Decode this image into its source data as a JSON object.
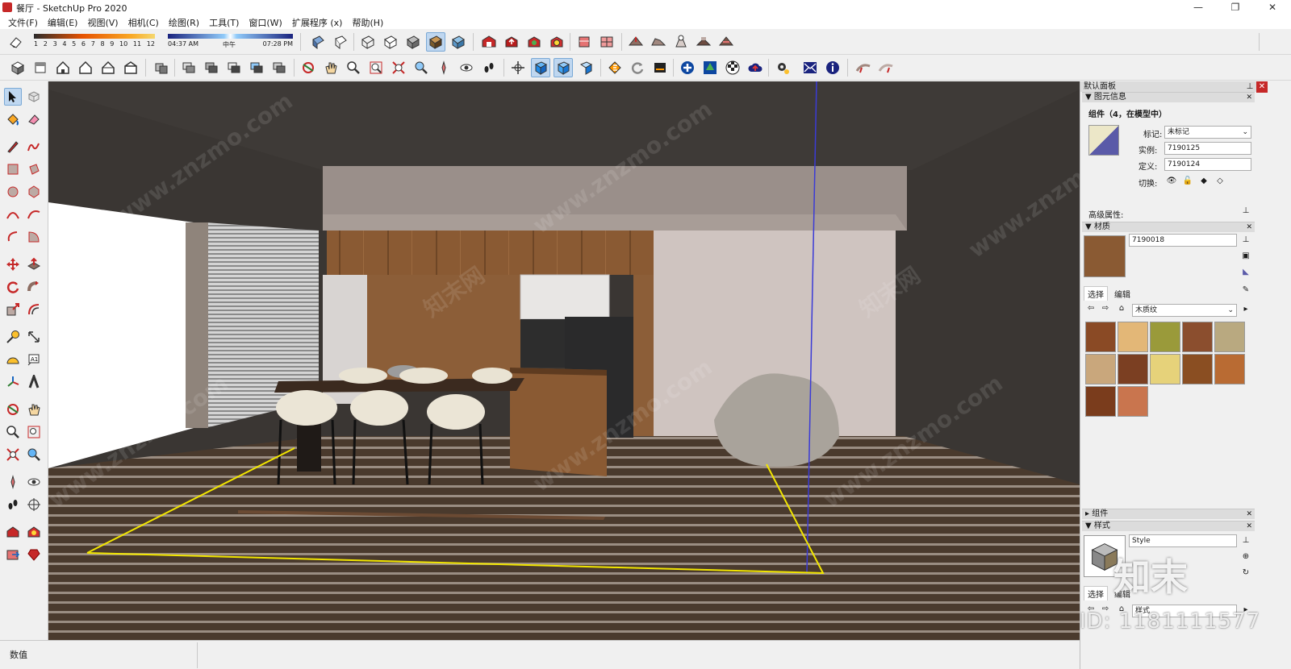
{
  "window": {
    "title": "餐厅 - SketchUp Pro 2020",
    "controls": [
      "—",
      "❐",
      "✕"
    ]
  },
  "menu": [
    "文件(F)",
    "编辑(E)",
    "视图(V)",
    "相机(C)",
    "绘图(R)",
    "工具(T)",
    "窗口(W)",
    "扩展程序 (x)",
    "帮助(H)"
  ],
  "shadow": {
    "months": [
      "1",
      "2",
      "3",
      "4",
      "5",
      "6",
      "7",
      "8",
      "9",
      "10",
      "11",
      "12"
    ],
    "time_start": "04:37 AM",
    "time_mid": "中午",
    "time_end": "07:28 PM"
  },
  "status": {
    "measure_label": "数值"
  },
  "tray": {
    "title": "默认面板",
    "entity_info": {
      "header": "图元信息",
      "heading": "组件（4，在模型中）",
      "tag_label": "标记:",
      "tag_value": "未标记",
      "instance_label": "实例:",
      "instance_value": "7190125",
      "definition_label": "定义:",
      "definition_value": "7190124",
      "toggle_label": "切换:",
      "advanced_label": "高级属性:"
    },
    "materials": {
      "header": "材质",
      "current_name": "7190018",
      "tab_select": "选择",
      "tab_edit": "编辑",
      "library": "木质纹",
      "swatch_colors": [
        "#8a4a25",
        "#e3b777",
        "#9a9a3a",
        "#8b4e2e",
        "#b9a980",
        "#c9a77c",
        "#7b3f22",
        "#e6d27a",
        "#8a4e22",
        "#b96b33",
        "#7a3c1c",
        "#c9754e"
      ]
    },
    "components": {
      "header": "组件"
    },
    "styles": {
      "header": "样式",
      "name": "Style",
      "tab_select": "选择",
      "tab_edit": "编辑",
      "library": "样式"
    }
  },
  "watermarks": {
    "site": "www.znzmo.com",
    "brand": "知末网",
    "logo": "知末",
    "id": "ID: 1181111577"
  },
  "colors": {
    "selection": "#f2e600",
    "axis_blue": "#3b3bd6",
    "wall_dark": "#3a3633",
    "soffit": "#9a8f8a"
  }
}
